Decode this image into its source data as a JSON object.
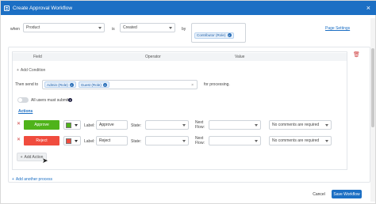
{
  "window": {
    "title": "Create Approval Workflow",
    "icon": "workflow-icon",
    "close": "×"
  },
  "criteria": {
    "when_label": "when",
    "module_value": "Product",
    "is_label": "is",
    "event_value": "Created",
    "by_label": "by",
    "by_chip": "Contributor (Role)",
    "page_settings": "Page Settings"
  },
  "criteria_table": {
    "headers": [
      "Field",
      "Operator",
      "Value"
    ],
    "add_condition": "Add Condition",
    "delete_icon": "trash-icon"
  },
  "send_to": {
    "label": "Then send to",
    "chips": [
      "Admin (Role)",
      "Guest (Role)"
    ],
    "suffix": "for processing."
  },
  "all_users": {
    "label": "All users must submit",
    "info": "i"
  },
  "actions": {
    "heading": "Actions",
    "rows": [
      {
        "button_label": "Approve",
        "button_color": "#4fb31a",
        "swatch_color": "#4fb31a",
        "label_caption": "Label:",
        "label_value": "Approve",
        "state_caption": "State:",
        "next_flow_caption": "Next\nFlow:",
        "comments_value": "No comments are required"
      },
      {
        "button_label": "Reject",
        "button_color": "#f04c3e",
        "swatch_color": "#f04c3e",
        "label_caption": "Label:",
        "label_value": "Reject",
        "state_caption": "State:",
        "next_flow_caption": "Next\nFlow:",
        "comments_value": "No comments are required"
      }
    ],
    "add_action": "Add Action"
  },
  "add_process": "Add another process",
  "footer": {
    "cancel": "Cancel",
    "save": "Save Workflow"
  },
  "colors": {
    "accent": "#1c6fc4",
    "approve": "#4fb31a",
    "reject": "#f04c3e"
  }
}
